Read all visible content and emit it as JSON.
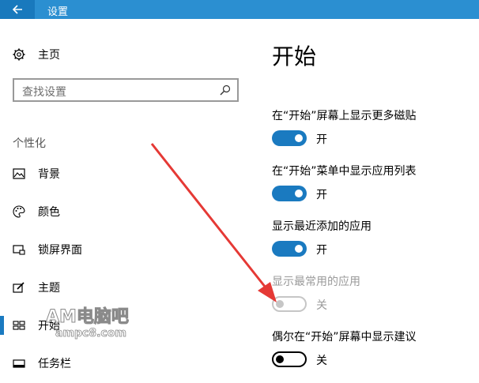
{
  "window": {
    "title": "设置"
  },
  "sidebar": {
    "home": "主页",
    "search_placeholder": "查找设置",
    "section": "个性化",
    "items": [
      {
        "label": "背景",
        "icon": "image-icon"
      },
      {
        "label": "颜色",
        "icon": "palette-icon"
      },
      {
        "label": "锁屏界面",
        "icon": "lock-screen-icon"
      },
      {
        "label": "主题",
        "icon": "theme-icon"
      },
      {
        "label": "开始",
        "icon": "start-icon",
        "selected": true
      },
      {
        "label": "任务栏",
        "icon": "taskbar-icon"
      }
    ]
  },
  "main": {
    "title": "开始",
    "settings": [
      {
        "label": "在“开始”屏幕上显示更多磁贴",
        "state": "开",
        "on": true,
        "enabled": true
      },
      {
        "label": "在“开始”菜单中显示应用列表",
        "state": "开",
        "on": true,
        "enabled": true
      },
      {
        "label": "显示最近添加的应用",
        "state": "开",
        "on": true,
        "enabled": true
      },
      {
        "label": "显示最常用的应用",
        "state": "关",
        "on": false,
        "enabled": false
      },
      {
        "label": "偶尔在“开始”屏幕中显示建议",
        "state": "关",
        "on": false,
        "enabled": true
      }
    ]
  },
  "watermark": {
    "line1": "AM电脑吧",
    "line2": "ampc8.com"
  },
  "colors": {
    "accent": "#1a7ac0",
    "titlebar": "#2b8fd1",
    "annotation_arrow": "#e53935"
  }
}
